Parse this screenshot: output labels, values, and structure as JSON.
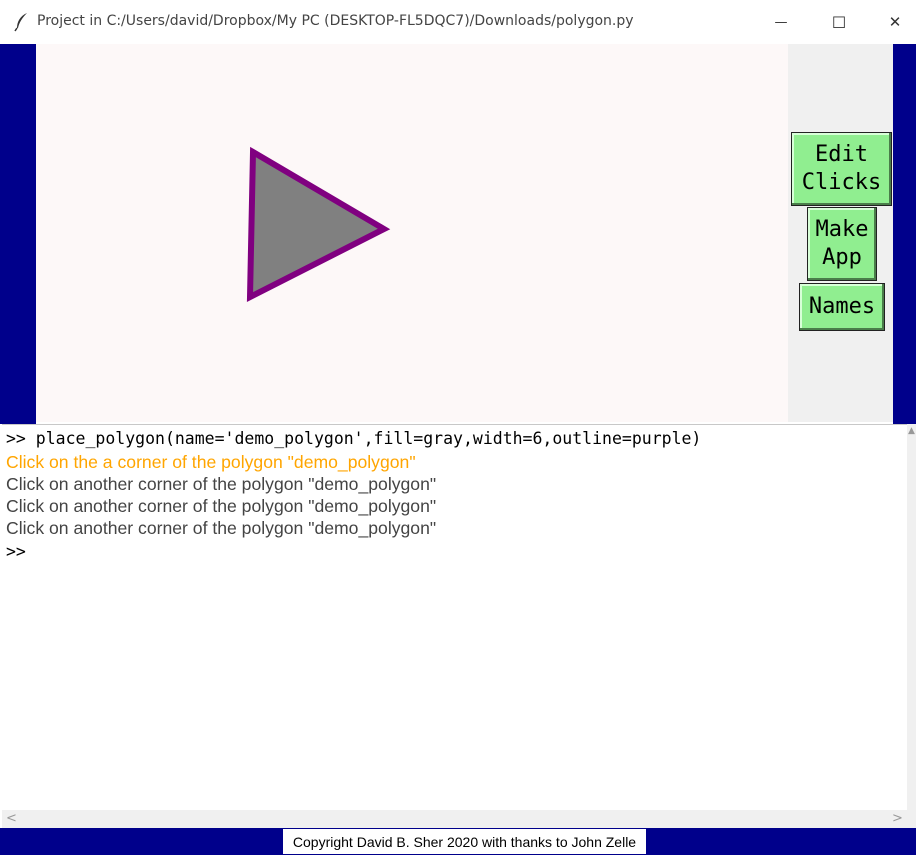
{
  "window": {
    "title": "Project in C:/Users/david/Dropbox/My PC (DESKTOP-FL5DQC7)/Downloads/polygon.py",
    "minimize_glyph": "—",
    "maximize_glyph": "☐",
    "close_glyph": "✕"
  },
  "colors": {
    "background_blue": "#00008b",
    "canvas_bg": "#fdf8f8",
    "button_green": "#90ee90",
    "polygon_fill": "#808080",
    "polygon_outline": "#800080",
    "orange_message": "#ffa500"
  },
  "side_buttons": {
    "edit_clicks": "Edit Clicks",
    "make_app": "Make App",
    "names": "Names"
  },
  "console": {
    "command": ">> place_polygon(name='demo_polygon',fill=gray,width=6,outline=purple)",
    "messages": [
      "Click on the a corner of the polygon \"demo_polygon\"",
      "Click on another corner of the polygon \"demo_polygon\"",
      "Click on another corner of the polygon \"demo_polygon\"",
      "Click on another corner of the polygon \"demo_polygon\""
    ],
    "prompt": ">>"
  },
  "scrollbars": {
    "up": "▲",
    "left": "<",
    "right": ">"
  },
  "footer": {
    "copyright": "Copyright David B. Sher 2020 with thanks to John Zelle"
  }
}
